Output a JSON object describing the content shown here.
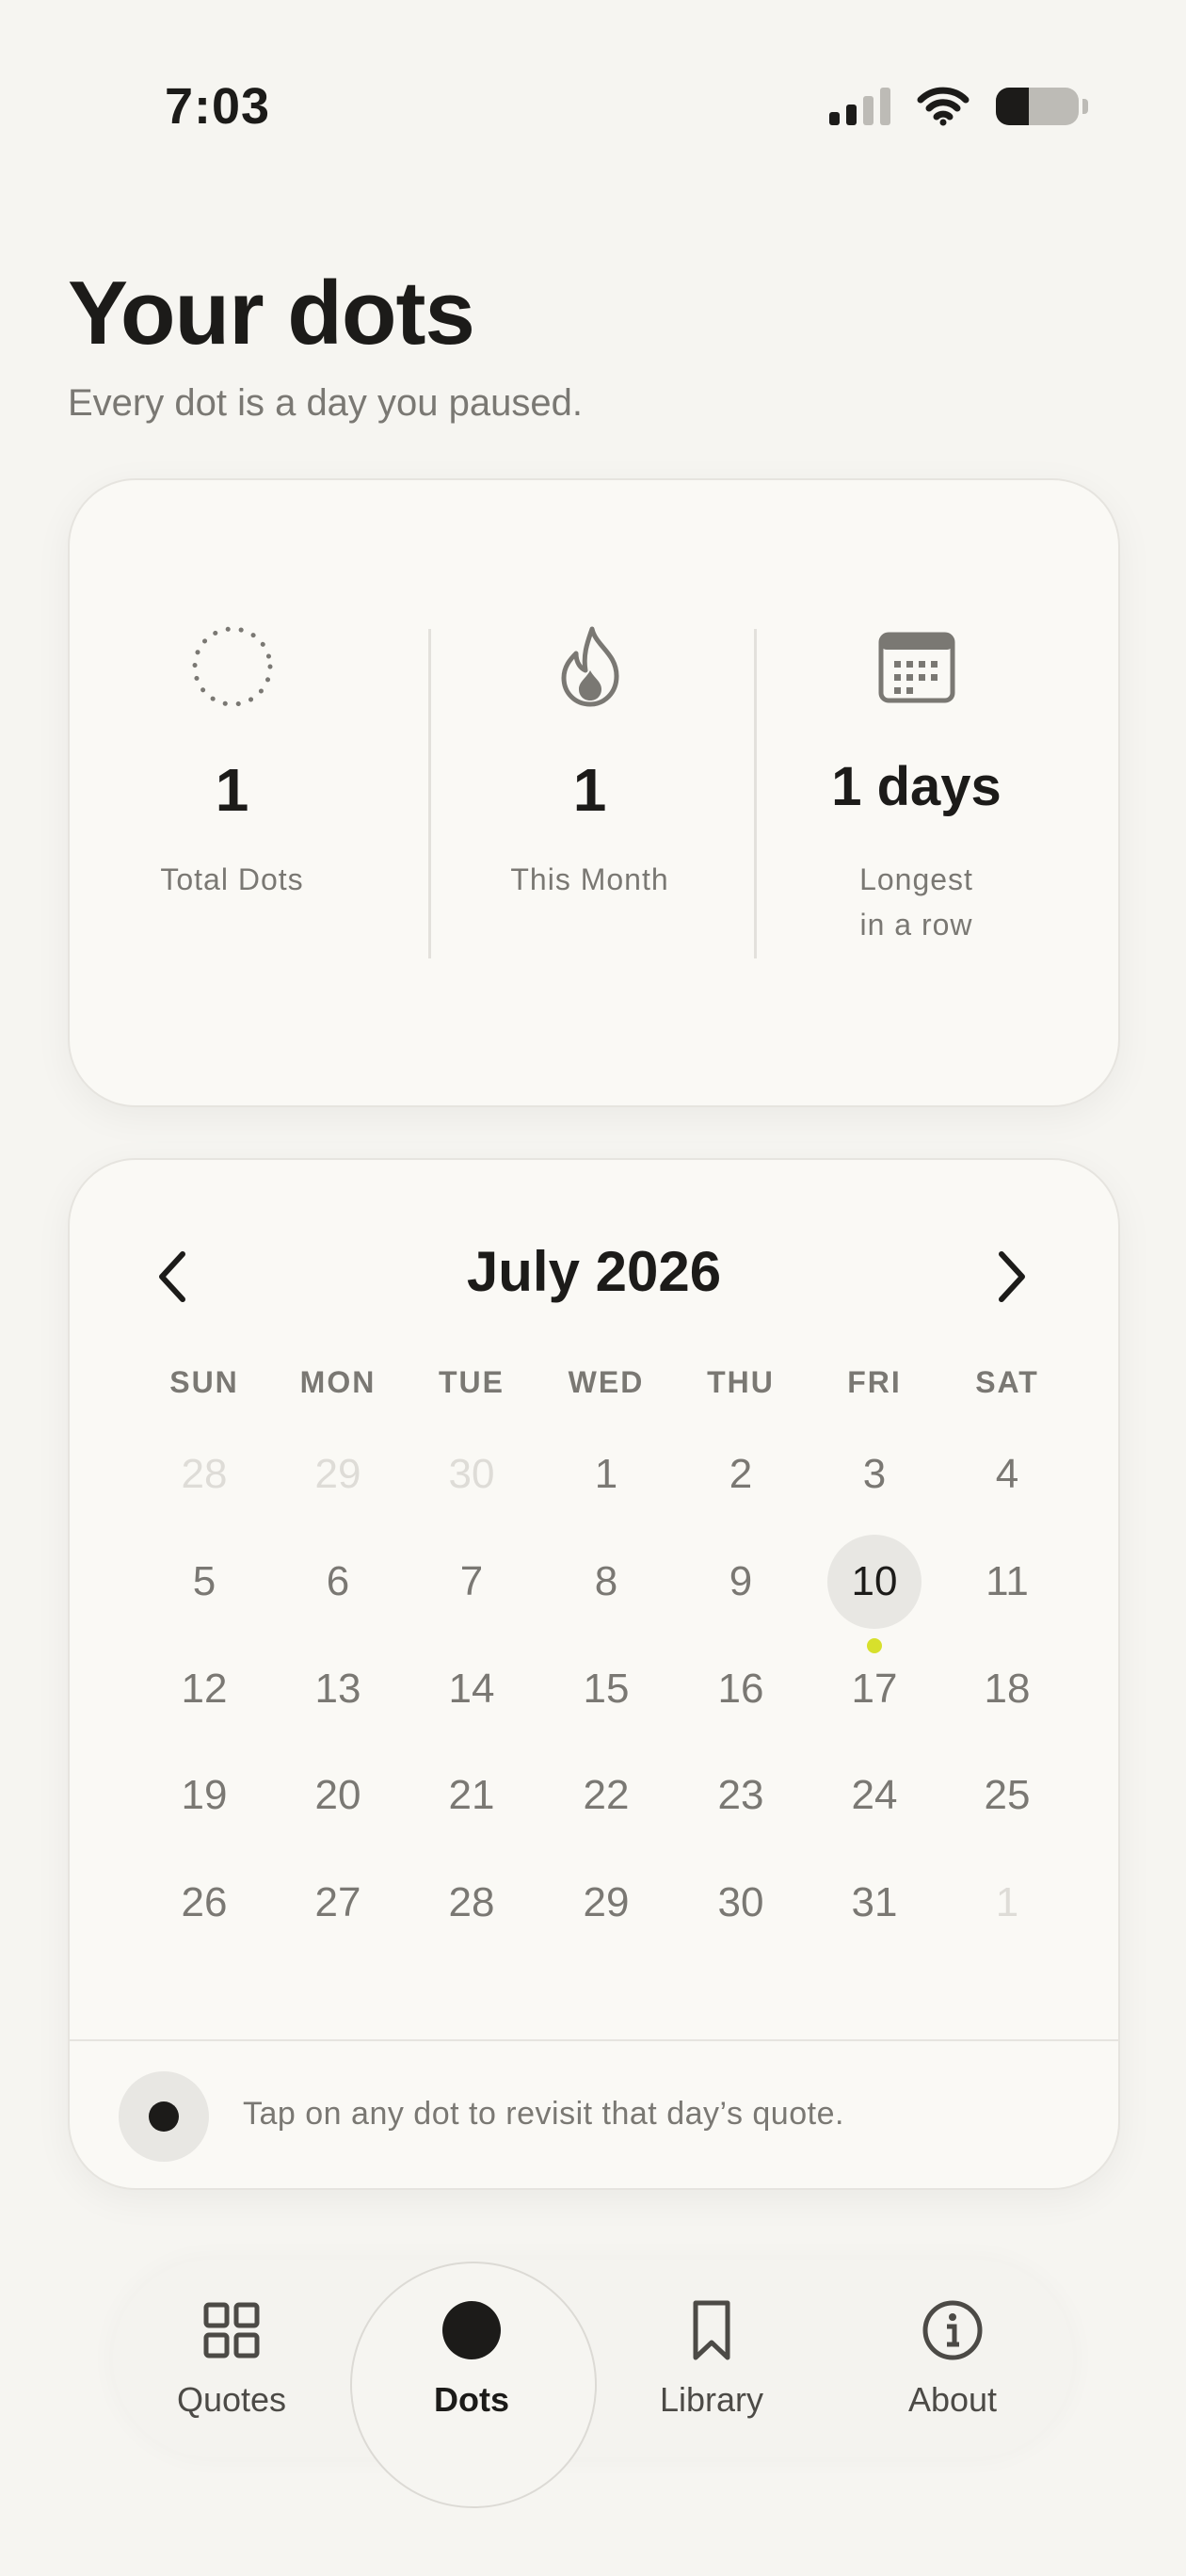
{
  "status_bar": {
    "time": "7:03",
    "signal_icon": "cellular-signal-icon",
    "wifi_icon": "wifi-icon",
    "battery_icon": "battery-icon"
  },
  "header": {
    "title": "Your dots",
    "subtitle": "Every dot is a day you paused."
  },
  "stats": [
    {
      "icon": "dotted-circle-icon",
      "value": "1",
      "label": "Total Dots"
    },
    {
      "icon": "flame-icon",
      "value": "1",
      "label": "This Month"
    },
    {
      "icon": "calendar-icon",
      "value": "1 days",
      "label_line1": "Longest",
      "label_line2": "in a row"
    }
  ],
  "calendar": {
    "month_label": "July 2026",
    "prev_icon": "chevron-left-icon",
    "next_icon": "chevron-right-icon",
    "weekdays": [
      "SUN",
      "MON",
      "TUE",
      "WED",
      "THU",
      "FRI",
      "SAT"
    ],
    "weeks": [
      [
        "28",
        "29",
        "30",
        "1",
        "2",
        "3",
        "4"
      ],
      [
        "5",
        "6",
        "7",
        "8",
        "9",
        "10",
        "11"
      ],
      [
        "12",
        "13",
        "14",
        "15",
        "16",
        "17",
        "18"
      ],
      [
        "19",
        "20",
        "21",
        "22",
        "23",
        "24",
        "25"
      ],
      [
        "26",
        "27",
        "28",
        "29",
        "30",
        "31",
        "1"
      ]
    ],
    "today": "10",
    "dot_days": [
      "10"
    ],
    "dot_color": "#d7e02c",
    "hint_text": "Tap on any dot to revisit that day’s quote."
  },
  "tabbar": {
    "tabs": [
      {
        "label": "Quotes",
        "icon": "grid-icon",
        "active": false
      },
      {
        "label": "Dots",
        "icon": "dot-icon",
        "active": true
      },
      {
        "label": "Library",
        "icon": "bookmark-icon",
        "active": false
      },
      {
        "label": "About",
        "icon": "info-icon",
        "active": false
      }
    ]
  },
  "colors": {
    "background": "#f6f5f1",
    "card": "#faf9f5",
    "text": "#1c1b19",
    "muted": "#7a7873",
    "accent_dot": "#d7e02c"
  }
}
